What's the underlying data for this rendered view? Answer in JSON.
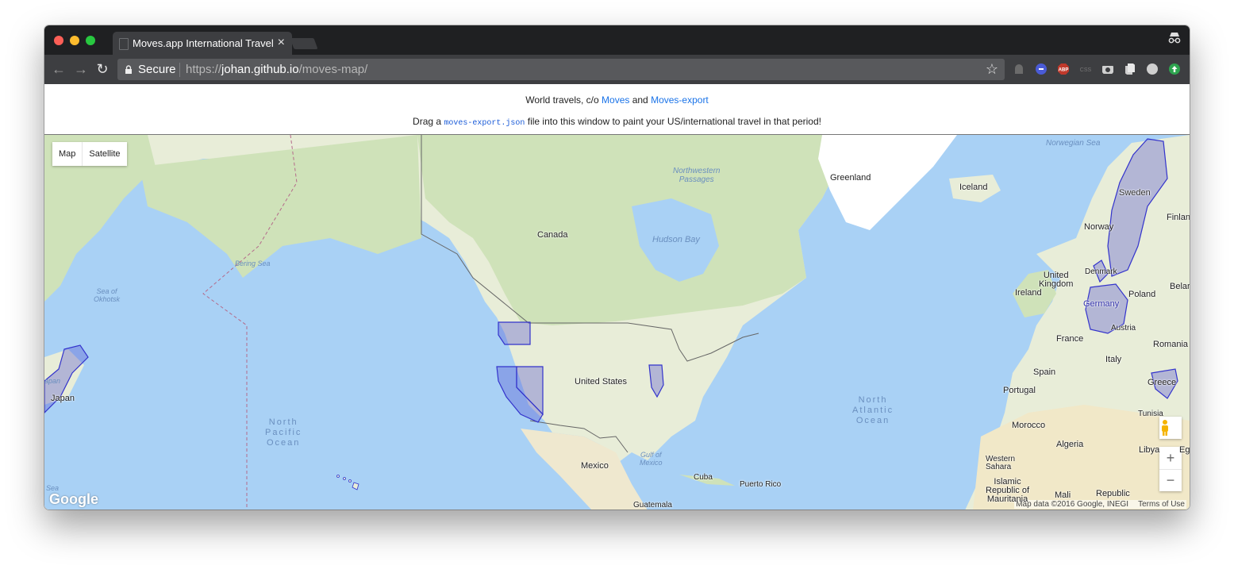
{
  "tab": {
    "title": "Moves.app International Travel"
  },
  "toolbar": {
    "secure_label": "Secure",
    "url_scheme": "https://",
    "url_host": "johan.github.io",
    "url_path": "/moves-map/"
  },
  "header": {
    "line1_prefix": "World travels, c/o ",
    "moves_link": "Moves",
    "line1_and": " and ",
    "moves_export_link": "Moves-export",
    "line2_prefix": "Drag a ",
    "line2_code": "moves-export.json",
    "line2_suffix": " file into this window to paint your US/international travel in that period!"
  },
  "map": {
    "type_buttons": {
      "map": "Map",
      "satellite": "Satellite"
    },
    "google_logo": "Google",
    "attribution": "Map data ©2016 Google, INEGI",
    "terms": "Terms of Use",
    "zoom_in": "+",
    "zoom_out": "−",
    "highlight_color": "#3333cc",
    "labels": {
      "greenland": "Greenland",
      "iceland": "Iceland",
      "canada": "Canada",
      "hudson_bay": "Hudson Bay",
      "northwestern_passages": "Northwestern\nPassages",
      "norwegian_sea": "Norwegian Sea",
      "sweden": "Sweden",
      "finland": "Finlan",
      "norway": "Norway",
      "united_kingdom": "United\nKingdom",
      "denmark": "Denmark",
      "ireland": "Ireland",
      "germany": "Germany",
      "poland": "Poland",
      "belarus": "Belar",
      "austria": "Austria",
      "france": "France",
      "romania": "Romania",
      "italy": "Italy",
      "spain": "Spain",
      "portugal": "Portugal",
      "greece": "Greece",
      "tunisia": "Tunisia",
      "morocco": "Morocco",
      "algeria": "Algeria",
      "libya": "Libya",
      "western_sahara": "Western\nSahara",
      "mauritania": "Islamic\nRepublic of\nMauritania",
      "mali": "Mali",
      "republic": "Republic",
      "egypt": "Eg",
      "bering_sea": "Bering Sea",
      "sea_of_okhotsk": "Sea of\nOkhotsk",
      "japan": "Japan",
      "japan_partial": "apan",
      "united_states": "United States",
      "mexico": "Mexico",
      "gulf_of_mexico": "Gulf of\nMexico",
      "cuba": "Cuba",
      "puerto_rico": "Puerto Rico",
      "guatemala": "Guatemala",
      "north_pacific_ocean": "North\nPacific\nOcean",
      "north_atlantic_ocean": "North\nAtlantic\nOcean",
      "sea_partial": "Sea"
    }
  }
}
